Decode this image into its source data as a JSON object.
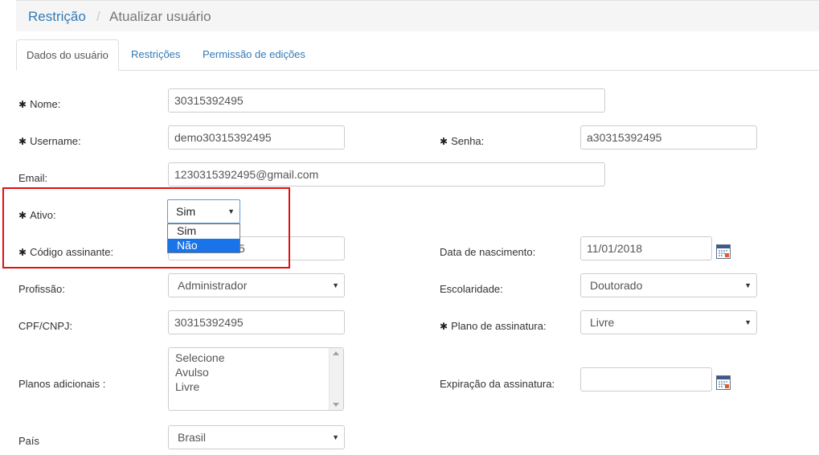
{
  "breadcrumb": {
    "link": "Restrição",
    "separator": "/",
    "current": "Atualizar usuário"
  },
  "tabs": [
    {
      "label": "Dados do usuário",
      "active": true
    },
    {
      "label": "Restrições",
      "active": false
    },
    {
      "label": "Permissão de edições",
      "active": false
    }
  ],
  "required_marker": "✱",
  "form": {
    "nome": {
      "label": "Nome:",
      "value": "30315392495"
    },
    "username": {
      "label": "Username:",
      "value": "demo30315392495"
    },
    "senha": {
      "label": "Senha:",
      "value": "a30315392495"
    },
    "email": {
      "label": "Email:",
      "value": "1230315392495@gmail.com"
    },
    "ativo": {
      "label": "Ativo:",
      "selected": "Sim",
      "options": [
        "Sim",
        "Não"
      ],
      "highlighted_option": "Não"
    },
    "codigo_assinante": {
      "label": "Código assinante:",
      "value_visible_tail": "5"
    },
    "data_nascimento": {
      "label": "Data de nascimento:",
      "value": "11/01/2018"
    },
    "profissao": {
      "label": "Profissão:",
      "selected": "Administrador"
    },
    "escolaridade": {
      "label": "Escolaridade:",
      "selected": "Doutorado"
    },
    "cpf_cnpj": {
      "label": "CPF/CNPJ:",
      "value": "30315392495"
    },
    "plano_assinatura": {
      "label": "Plano de assinatura:",
      "selected": "Livre"
    },
    "planos_adicionais": {
      "label": "Planos adicionais :",
      "options": [
        "Selecione",
        "Avulso",
        "Livre"
      ]
    },
    "expiracao_assinatura": {
      "label": "Expiração da assinatura:",
      "value": ""
    },
    "pais": {
      "label": "País",
      "selected": "Brasil"
    }
  },
  "icons": {
    "calendar": "calendar-icon",
    "caret": "▼"
  },
  "colors": {
    "link": "#337ab7",
    "highlight_box": "#e20f0f",
    "selected_option": "#1a73e8"
  }
}
